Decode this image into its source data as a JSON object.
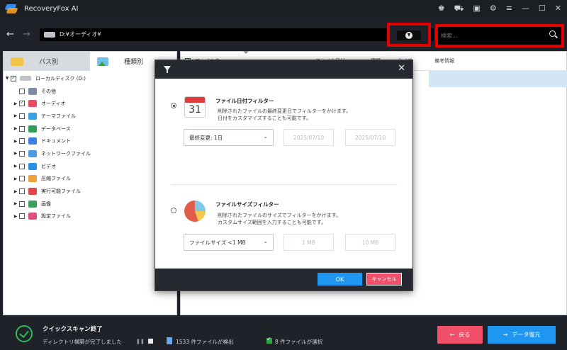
{
  "window": {
    "title": "RecoveryFox AI"
  },
  "titlebar_icons": [
    "user-icon",
    "cart-icon",
    "chat-icon",
    "settings-icon",
    "menu-icon",
    "minimize-icon",
    "maximize-icon",
    "close-icon"
  ],
  "address": {
    "path": "D:¥オーディオ¥",
    "search_placeholder": "検索..."
  },
  "left_panel": {
    "tabs": [
      {
        "label": "パス別",
        "icon": "folder-icon"
      },
      {
        "label": "種類別",
        "icon": "image-icon"
      }
    ],
    "root": {
      "label": "ローカルディスク (D:)",
      "checked": true
    },
    "items": [
      {
        "label": "その他",
        "color": "#7a8aa8",
        "checked": false
      },
      {
        "label": "オーディオ",
        "color": "#e84a5f",
        "checked": true
      },
      {
        "label": "テーマファイル",
        "color": "#3aa0e8",
        "checked": false
      },
      {
        "label": "データベース",
        "color": "#2f9e5a",
        "checked": false
      },
      {
        "label": "ドキュメント",
        "color": "#3b7fe0",
        "checked": false
      },
      {
        "label": "ネットワークファイル",
        "color": "#4a9ae0",
        "checked": false
      },
      {
        "label": "ビデオ",
        "color": "#2d8fe0",
        "checked": false
      },
      {
        "label": "圧縮ファイル",
        "color": "#f0a23a",
        "checked": false
      },
      {
        "label": "実行可能ファイル",
        "color": "#e04848",
        "checked": false
      },
      {
        "label": "画像",
        "color": "#3aa060",
        "checked": false
      },
      {
        "label": "設定ファイル",
        "color": "#e0507a",
        "checked": false
      }
    ]
  },
  "right_panel": {
    "columns": [
      "ファイル名",
      "ファイル日付",
      "種類",
      "サイズ",
      "備考情報"
    ]
  },
  "dialog": {
    "date_filter": {
      "title": "ファイル日付フィルター",
      "desc_line1": "削除されたファイルの最終変更日でフィルターをかけます。",
      "desc_line2": "日付をカスタマイズすることも可能です。",
      "calendar_day": "31",
      "select_value": "最終変更: 1日",
      "date_from": "2025/07/10",
      "date_to": "2025/07/10",
      "selected": true
    },
    "size_filter": {
      "title": "ファイルサイズフィルター",
      "desc_line1": "削除されたファイルのサイズでフィルターをかけます。",
      "desc_line2": "カスタムサイズ範囲を入力することも可能です。",
      "select_value": "ファイルサイズ <1 MB",
      "size_from": "1 MB",
      "size_to": "10 MB",
      "selected": false
    },
    "ok_label": "OK",
    "cancel_label": "キャンセル"
  },
  "status": {
    "title": "クイックスキャン終了",
    "subtitle": "ディレクトリ構築が完了しました",
    "found": "1533 件ファイルが検出",
    "selected": "8 件ファイルが選択",
    "back_label": "戻る",
    "recover_label": "データ復元"
  },
  "colors": {
    "accent_blue": "#1f97f2",
    "accent_red": "#f1506b",
    "highlight_red": "#e40000",
    "success_green": "#2fba5b"
  }
}
